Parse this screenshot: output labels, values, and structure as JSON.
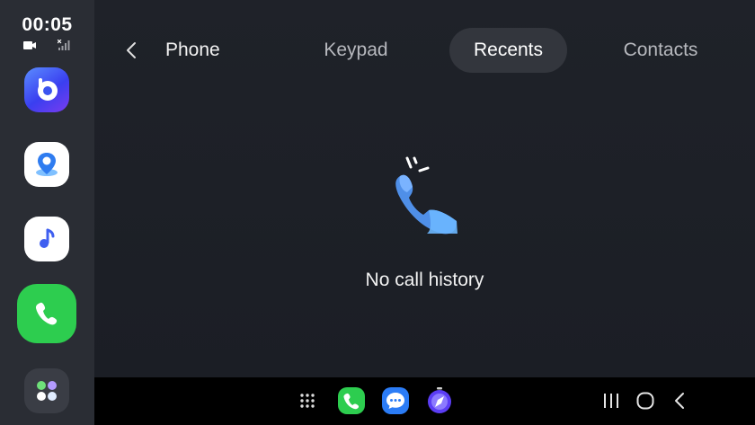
{
  "status": {
    "time": "00:05"
  },
  "rail": {
    "apps": [
      {
        "name": "Bixby",
        "icon": "bixby-icon"
      },
      {
        "name": "Maps",
        "icon": "map-pin-icon"
      },
      {
        "name": "Music",
        "icon": "music-note-icon"
      },
      {
        "name": "Phone",
        "icon": "phone-icon",
        "active": true
      },
      {
        "name": "App drawer",
        "icon": "apps-grid-icon"
      }
    ]
  },
  "header": {
    "title": "Phone",
    "back_icon": "chevron-left-icon",
    "tabs": [
      {
        "label": "Keypad",
        "selected": false
      },
      {
        "label": "Recents",
        "selected": true
      },
      {
        "label": "Contacts",
        "selected": false
      }
    ]
  },
  "content": {
    "empty_icon": "phone-ringing-icon",
    "empty_message": "No call history"
  },
  "dock": {
    "items": [
      {
        "icon": "dots-grid-icon"
      },
      {
        "icon": "phone-icon"
      },
      {
        "icon": "messages-icon"
      },
      {
        "icon": "browser-icon"
      }
    ],
    "nav": [
      {
        "icon": "recents-nav-icon"
      },
      {
        "icon": "home-nav-icon"
      },
      {
        "icon": "back-nav-icon"
      }
    ]
  },
  "colors": {
    "accent_green": "#2dcd4f",
    "panel_bg": "#1d2027",
    "rail_bg": "#2a2d34",
    "selected_tab_bg": "#33363d",
    "icon_blue": "#5b8def"
  }
}
